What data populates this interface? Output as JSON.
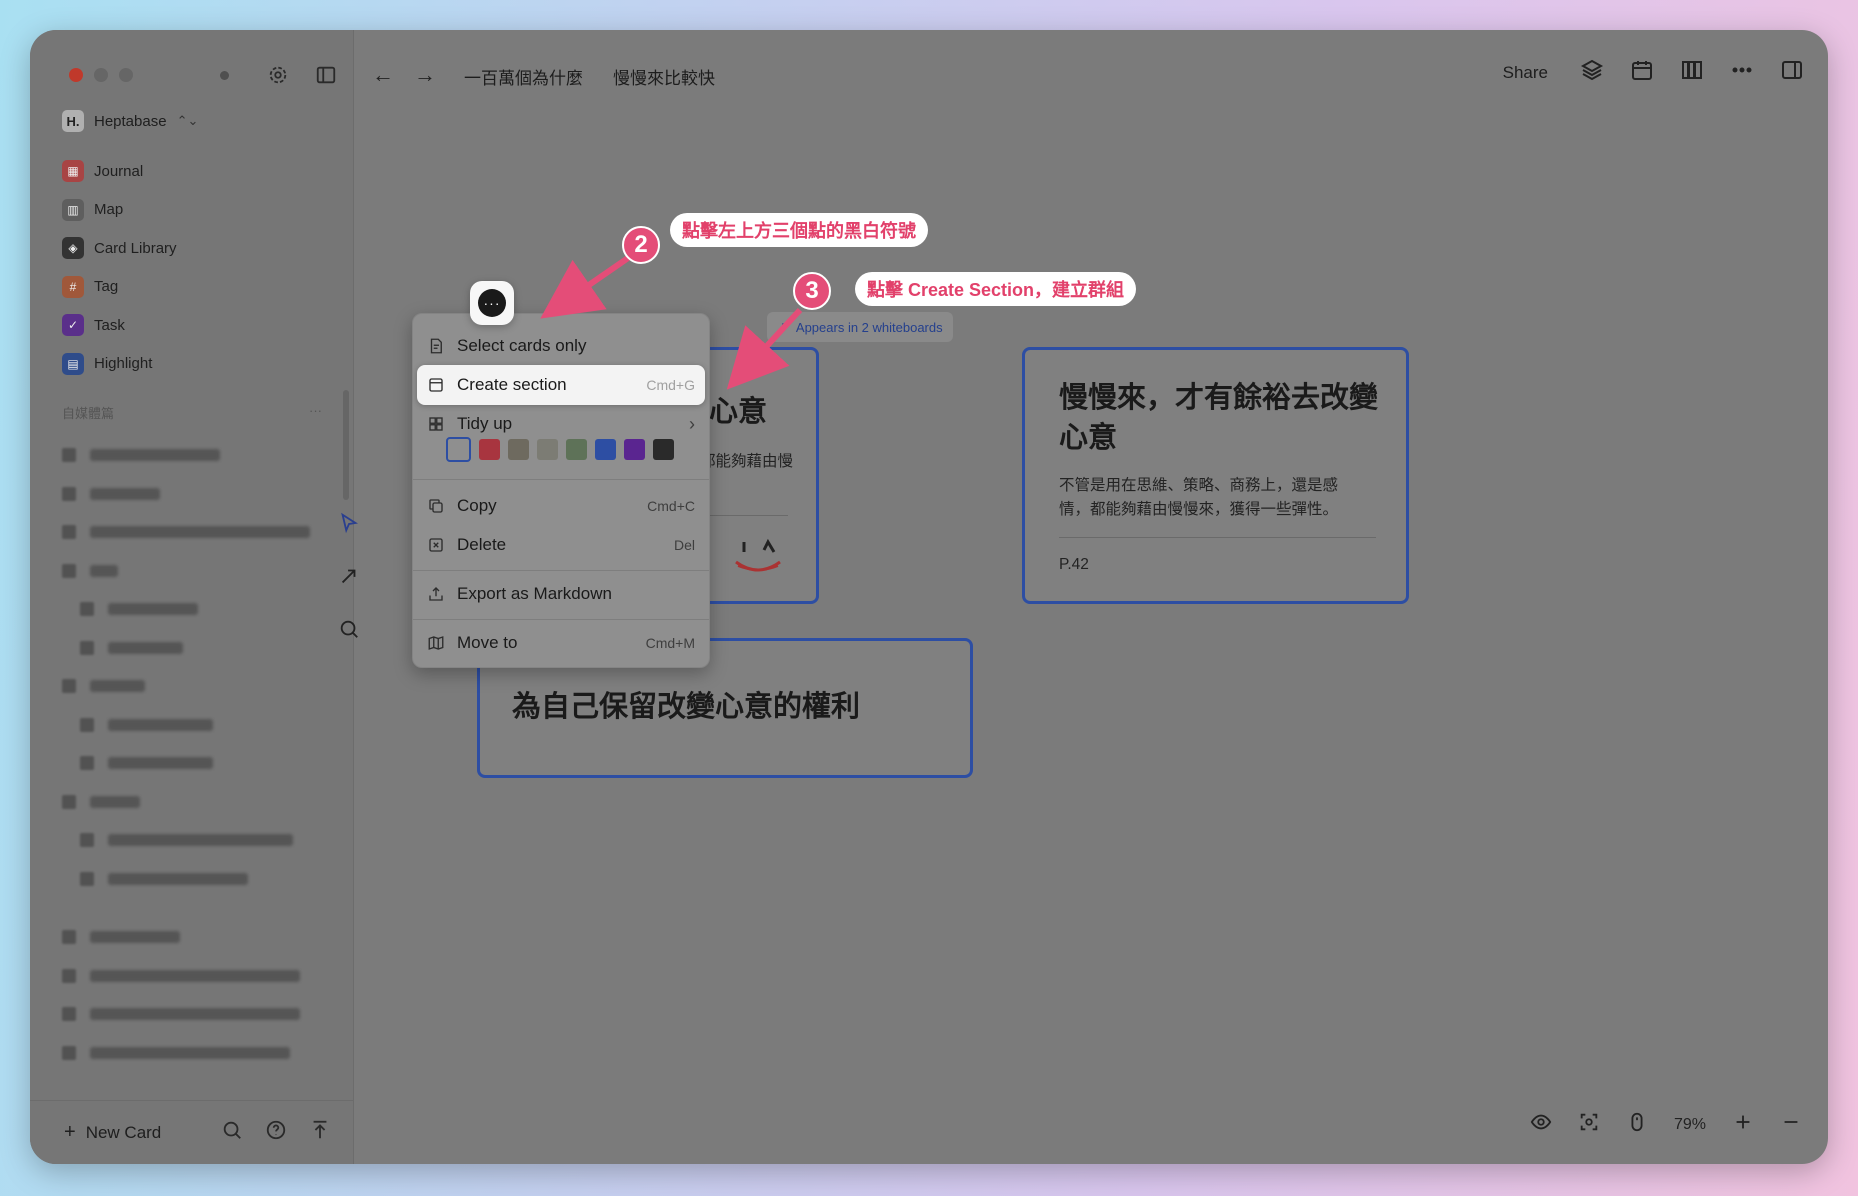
{
  "sidebar": {
    "workspace": {
      "badge": "H.",
      "name": "Heptabase"
    },
    "nav": [
      {
        "label": "Journal",
        "icon": "journal-icon"
      },
      {
        "label": "Map",
        "icon": "map-icon"
      },
      {
        "label": "Card Library",
        "icon": "card-library-icon"
      },
      {
        "label": "Tag",
        "icon": "tag-icon"
      },
      {
        "label": "Task",
        "icon": "task-icon"
      },
      {
        "label": "Highlight",
        "icon": "highlight-icon"
      }
    ],
    "section_title": "自媒體篇",
    "section_more": "···",
    "new_card": "New Card"
  },
  "topbar": {
    "breadcrumb_1": "一百萬個為什麼",
    "breadcrumb_2": "慢慢來比較快",
    "share": "Share"
  },
  "canvas": {
    "appears_in": "Appears in 2 whiteboards",
    "card1": {
      "title": "餘裕去改變心意",
      "body": "務上，還是感情，都能夠藉由慢"
    },
    "card2": {
      "title": "慢慢來，才有餘裕去改變心意",
      "body": "不管是用在思維、策略、商務上，還是感情，都能夠藉由慢慢來，獲得一些彈性。",
      "page": "P.42"
    },
    "card3": {
      "title": "為自己保留改變心意的權利"
    }
  },
  "context_menu": {
    "select_cards_only": "Select cards only",
    "create_section": "Create section",
    "create_section_shortcut": "Cmd+G",
    "tidy_up": "Tidy up",
    "copy": "Copy",
    "copy_shortcut": "Cmd+C",
    "delete": "Delete",
    "delete_shortcut": "Del",
    "export_markdown": "Export as Markdown",
    "move_to": "Move to",
    "move_to_shortcut": "Cmd+M",
    "swatch_colors": [
      "#a8353f",
      "#6e6a5f",
      "#7c7c74",
      "#5e7258",
      "#2d4ea3",
      "#5a2590",
      "#2a2a2a"
    ]
  },
  "annotations": {
    "step2_number": "2",
    "step2_text": "點擊左上方三個點的黑白符號",
    "step3_number": "3",
    "step3_text": "點擊 Create Section，建立群組",
    "accent": "#e44d78"
  },
  "status": {
    "zoom": "79%"
  }
}
